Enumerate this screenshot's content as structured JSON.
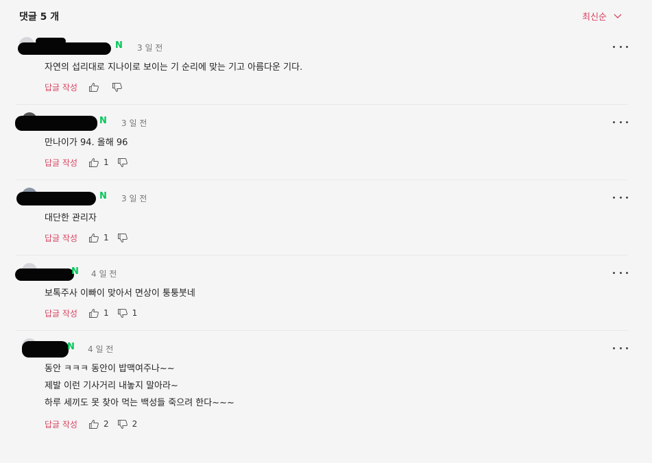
{
  "header": {
    "title": "댓글 5 개",
    "sort_label": "최신순"
  },
  "labels": {
    "reply": "답글 작성",
    "verified_badge": "N"
  },
  "comments": [
    {
      "time": "3 일 전",
      "lines": [
        "자연의 섭리대로 지나이로 보이는 기 순리에 맞는 기고 아름다운 기다."
      ],
      "likes": "",
      "dislikes": ""
    },
    {
      "time": "3 일 전",
      "lines": [
        "만나이가 94. 올해 96"
      ],
      "likes": "1",
      "dislikes": ""
    },
    {
      "time": "3 일 전",
      "lines": [
        "대단한 관리자"
      ],
      "likes": "1",
      "dislikes": ""
    },
    {
      "time": "4 일 전",
      "lines": [
        "보톡주사 이빠이 맞아서 면상이 퉁퉁붓네"
      ],
      "likes": "1",
      "dislikes": "1"
    },
    {
      "time": "4 일 전",
      "lines": [
        "동안 ㅋㅋㅋ 동안이 밥맥여주나~~",
        "제발 이런 기사거리 내놓지 말아라~",
        "하루 세끼도 못 찾아 먹는 백성들 죽으려 한다~~~"
      ],
      "likes": "2",
      "dislikes": "2"
    }
  ]
}
